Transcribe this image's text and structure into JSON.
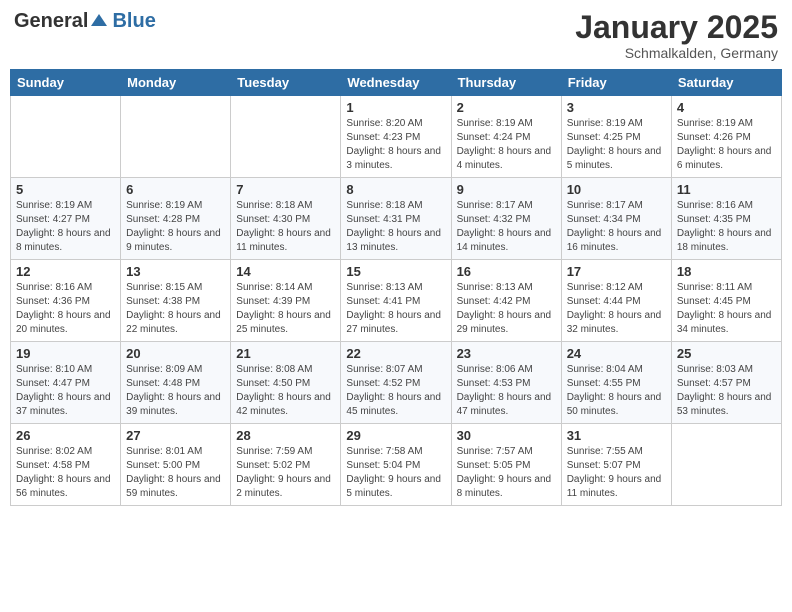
{
  "logo": {
    "text_general": "General",
    "text_blue": "Blue"
  },
  "title": "January 2025",
  "subtitle": "Schmalkalden, Germany",
  "days_of_week": [
    "Sunday",
    "Monday",
    "Tuesday",
    "Wednesday",
    "Thursday",
    "Friday",
    "Saturday"
  ],
  "weeks": [
    [
      {
        "day": "",
        "sunrise": "",
        "sunset": "",
        "daylight": ""
      },
      {
        "day": "",
        "sunrise": "",
        "sunset": "",
        "daylight": ""
      },
      {
        "day": "",
        "sunrise": "",
        "sunset": "",
        "daylight": ""
      },
      {
        "day": "1",
        "sunrise": "Sunrise: 8:20 AM",
        "sunset": "Sunset: 4:23 PM",
        "daylight": "Daylight: 8 hours and 3 minutes."
      },
      {
        "day": "2",
        "sunrise": "Sunrise: 8:19 AM",
        "sunset": "Sunset: 4:24 PM",
        "daylight": "Daylight: 8 hours and 4 minutes."
      },
      {
        "day": "3",
        "sunrise": "Sunrise: 8:19 AM",
        "sunset": "Sunset: 4:25 PM",
        "daylight": "Daylight: 8 hours and 5 minutes."
      },
      {
        "day": "4",
        "sunrise": "Sunrise: 8:19 AM",
        "sunset": "Sunset: 4:26 PM",
        "daylight": "Daylight: 8 hours and 6 minutes."
      }
    ],
    [
      {
        "day": "5",
        "sunrise": "Sunrise: 8:19 AM",
        "sunset": "Sunset: 4:27 PM",
        "daylight": "Daylight: 8 hours and 8 minutes."
      },
      {
        "day": "6",
        "sunrise": "Sunrise: 8:19 AM",
        "sunset": "Sunset: 4:28 PM",
        "daylight": "Daylight: 8 hours and 9 minutes."
      },
      {
        "day": "7",
        "sunrise": "Sunrise: 8:18 AM",
        "sunset": "Sunset: 4:30 PM",
        "daylight": "Daylight: 8 hours and 11 minutes."
      },
      {
        "day": "8",
        "sunrise": "Sunrise: 8:18 AM",
        "sunset": "Sunset: 4:31 PM",
        "daylight": "Daylight: 8 hours and 13 minutes."
      },
      {
        "day": "9",
        "sunrise": "Sunrise: 8:17 AM",
        "sunset": "Sunset: 4:32 PM",
        "daylight": "Daylight: 8 hours and 14 minutes."
      },
      {
        "day": "10",
        "sunrise": "Sunrise: 8:17 AM",
        "sunset": "Sunset: 4:34 PM",
        "daylight": "Daylight: 8 hours and 16 minutes."
      },
      {
        "day": "11",
        "sunrise": "Sunrise: 8:16 AM",
        "sunset": "Sunset: 4:35 PM",
        "daylight": "Daylight: 8 hours and 18 minutes."
      }
    ],
    [
      {
        "day": "12",
        "sunrise": "Sunrise: 8:16 AM",
        "sunset": "Sunset: 4:36 PM",
        "daylight": "Daylight: 8 hours and 20 minutes."
      },
      {
        "day": "13",
        "sunrise": "Sunrise: 8:15 AM",
        "sunset": "Sunset: 4:38 PM",
        "daylight": "Daylight: 8 hours and 22 minutes."
      },
      {
        "day": "14",
        "sunrise": "Sunrise: 8:14 AM",
        "sunset": "Sunset: 4:39 PM",
        "daylight": "Daylight: 8 hours and 25 minutes."
      },
      {
        "day": "15",
        "sunrise": "Sunrise: 8:13 AM",
        "sunset": "Sunset: 4:41 PM",
        "daylight": "Daylight: 8 hours and 27 minutes."
      },
      {
        "day": "16",
        "sunrise": "Sunrise: 8:13 AM",
        "sunset": "Sunset: 4:42 PM",
        "daylight": "Daylight: 8 hours and 29 minutes."
      },
      {
        "day": "17",
        "sunrise": "Sunrise: 8:12 AM",
        "sunset": "Sunset: 4:44 PM",
        "daylight": "Daylight: 8 hours and 32 minutes."
      },
      {
        "day": "18",
        "sunrise": "Sunrise: 8:11 AM",
        "sunset": "Sunset: 4:45 PM",
        "daylight": "Daylight: 8 hours and 34 minutes."
      }
    ],
    [
      {
        "day": "19",
        "sunrise": "Sunrise: 8:10 AM",
        "sunset": "Sunset: 4:47 PM",
        "daylight": "Daylight: 8 hours and 37 minutes."
      },
      {
        "day": "20",
        "sunrise": "Sunrise: 8:09 AM",
        "sunset": "Sunset: 4:48 PM",
        "daylight": "Daylight: 8 hours and 39 minutes."
      },
      {
        "day": "21",
        "sunrise": "Sunrise: 8:08 AM",
        "sunset": "Sunset: 4:50 PM",
        "daylight": "Daylight: 8 hours and 42 minutes."
      },
      {
        "day": "22",
        "sunrise": "Sunrise: 8:07 AM",
        "sunset": "Sunset: 4:52 PM",
        "daylight": "Daylight: 8 hours and 45 minutes."
      },
      {
        "day": "23",
        "sunrise": "Sunrise: 8:06 AM",
        "sunset": "Sunset: 4:53 PM",
        "daylight": "Daylight: 8 hours and 47 minutes."
      },
      {
        "day": "24",
        "sunrise": "Sunrise: 8:04 AM",
        "sunset": "Sunset: 4:55 PM",
        "daylight": "Daylight: 8 hours and 50 minutes."
      },
      {
        "day": "25",
        "sunrise": "Sunrise: 8:03 AM",
        "sunset": "Sunset: 4:57 PM",
        "daylight": "Daylight: 8 hours and 53 minutes."
      }
    ],
    [
      {
        "day": "26",
        "sunrise": "Sunrise: 8:02 AM",
        "sunset": "Sunset: 4:58 PM",
        "daylight": "Daylight: 8 hours and 56 minutes."
      },
      {
        "day": "27",
        "sunrise": "Sunrise: 8:01 AM",
        "sunset": "Sunset: 5:00 PM",
        "daylight": "Daylight: 8 hours and 59 minutes."
      },
      {
        "day": "28",
        "sunrise": "Sunrise: 7:59 AM",
        "sunset": "Sunset: 5:02 PM",
        "daylight": "Daylight: 9 hours and 2 minutes."
      },
      {
        "day": "29",
        "sunrise": "Sunrise: 7:58 AM",
        "sunset": "Sunset: 5:04 PM",
        "daylight": "Daylight: 9 hours and 5 minutes."
      },
      {
        "day": "30",
        "sunrise": "Sunrise: 7:57 AM",
        "sunset": "Sunset: 5:05 PM",
        "daylight": "Daylight: 9 hours and 8 minutes."
      },
      {
        "day": "31",
        "sunrise": "Sunrise: 7:55 AM",
        "sunset": "Sunset: 5:07 PM",
        "daylight": "Daylight: 9 hours and 11 minutes."
      },
      {
        "day": "",
        "sunrise": "",
        "sunset": "",
        "daylight": ""
      }
    ]
  ]
}
